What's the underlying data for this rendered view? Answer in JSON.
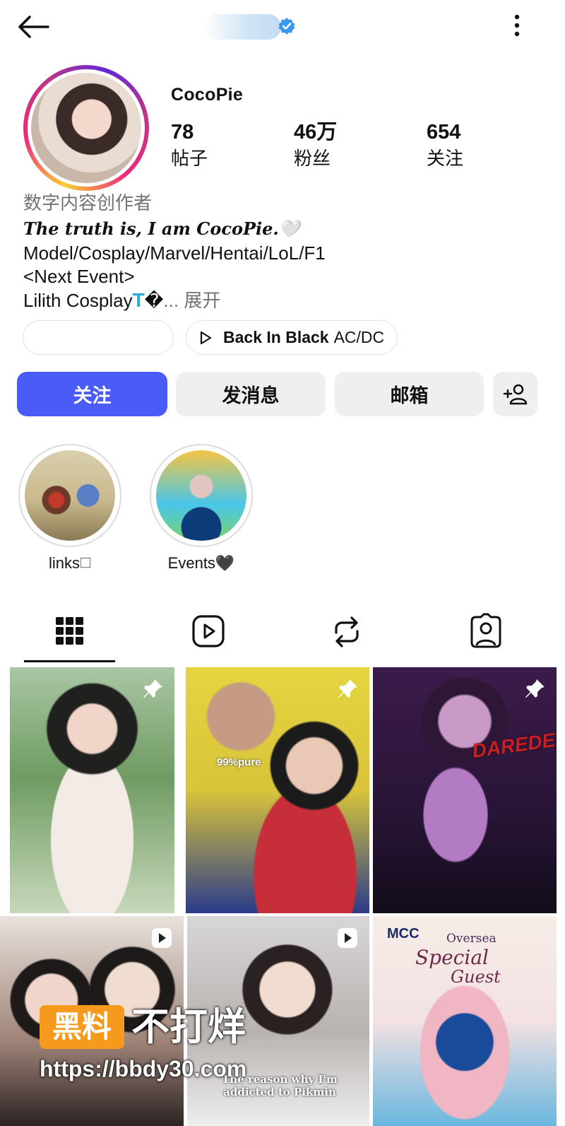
{
  "header": {
    "back_icon": "arrow-left-icon",
    "verified_icon": "verified-badge-icon",
    "more_icon": "more-vertical-icon"
  },
  "profile": {
    "username": "CocoPie",
    "stats": [
      {
        "value": "78",
        "label": "帖子"
      },
      {
        "value": "46万",
        "label": "粉丝"
      },
      {
        "value": "654",
        "label": "关注"
      }
    ]
  },
  "bio": {
    "category": "数字内容创作者",
    "line1": "The truth is, I am CocoPie.🤍",
    "line2": "Model/Cosplay/Marvel/Hentai/LoL/F1",
    "line3": "<Next Event>",
    "line4_text": "Lilith Cosplay",
    "line4_icon": "T",
    "line4_glyph": "�",
    "more_label": "... 展开"
  },
  "music": {
    "song": "Back In Black",
    "artist": "AC/DC",
    "icon": "play-icon"
  },
  "actions": {
    "follow": "关注",
    "message": "发消息",
    "email": "邮箱",
    "add_icon": "add-person-icon"
  },
  "highlights": [
    {
      "label": "links🗆"
    },
    {
      "label": "Events🖤"
    }
  ],
  "tabs": [
    {
      "icon": "grid-icon",
      "active": true
    },
    {
      "icon": "reels-icon",
      "active": false
    },
    {
      "icon": "reposts-icon",
      "active": false
    },
    {
      "icon": "tagged-icon",
      "active": false
    }
  ],
  "posts": [
    {
      "overlay_icon": "pin-icon",
      "caption": ""
    },
    {
      "overlay_icon": "pin-icon",
      "caption": "99%pure"
    },
    {
      "overlay_icon": "pin-icon",
      "caption": "DAREDEVIL"
    },
    {
      "overlay_icon": "reel-icon",
      "caption": ""
    },
    {
      "overlay_icon": "reel-icon",
      "caption": "The reason why I'm addicted to Pikmin"
    },
    {
      "overlay_icon": "",
      "caption_a": "MCC",
      "caption_b": "Oversea",
      "caption_c": "Special",
      "caption_d": "Guest"
    }
  ],
  "watermark": {
    "badge": "黑料",
    "title": "不打烊",
    "url": "https://bbdy30.com"
  },
  "colors": {
    "follow_button": "#4a5cf5",
    "verified": "#3897f0",
    "secondary_text": "#737373"
  }
}
